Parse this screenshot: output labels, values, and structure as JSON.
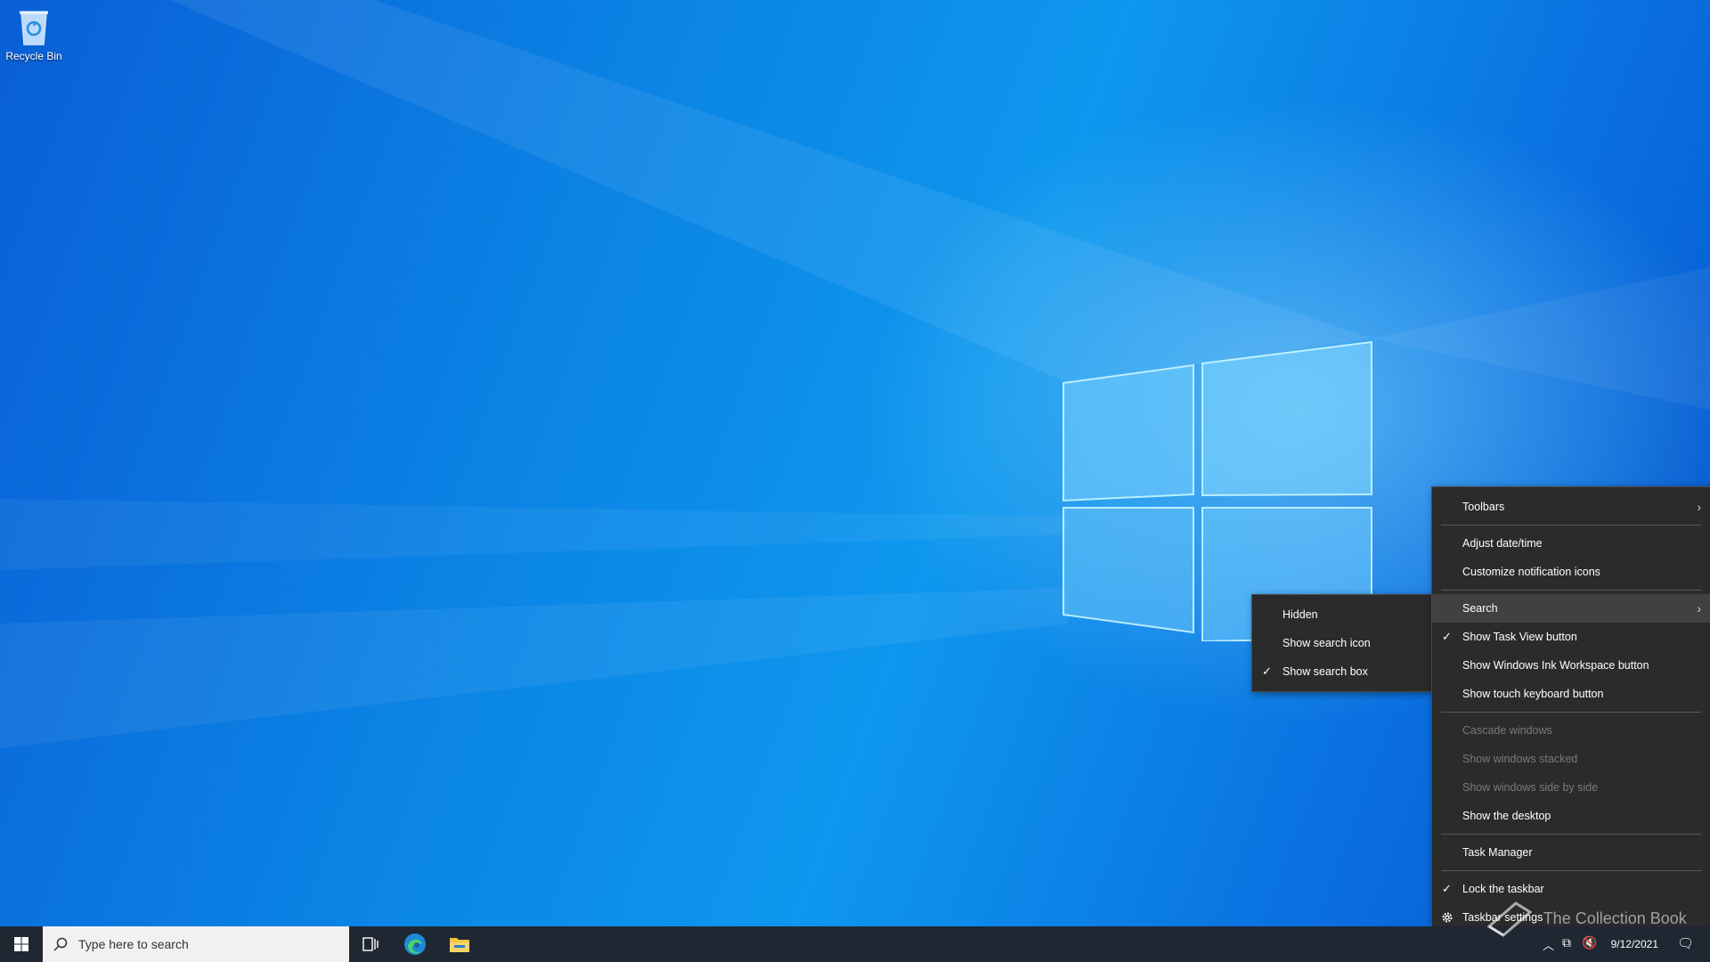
{
  "desktop": {
    "recycle_bin_label": "Recycle Bin"
  },
  "taskbar": {
    "search_placeholder": "Type here to search",
    "clock_date": "9/12/2021"
  },
  "watermark": "The Collection Book",
  "context_menu": {
    "items": [
      {
        "label": "Toolbars",
        "submenu": true
      },
      {
        "label": "Adjust date/time"
      },
      {
        "label": "Customize notification icons"
      },
      {
        "label": "Search",
        "submenu": true,
        "highlighted": true
      },
      {
        "label": "Show Task View button",
        "checked": true
      },
      {
        "label": "Show Windows Ink Workspace button"
      },
      {
        "label": "Show touch keyboard button"
      },
      {
        "label": "Cascade windows",
        "disabled": true
      },
      {
        "label": "Show windows stacked",
        "disabled": true
      },
      {
        "label": "Show windows side by side",
        "disabled": true
      },
      {
        "label": "Show the desktop"
      },
      {
        "label": "Task Manager"
      },
      {
        "label": "Lock the taskbar",
        "checked": true
      },
      {
        "label": "Taskbar settings",
        "icon": "gear-icon"
      }
    ]
  },
  "search_submenu": {
    "items": [
      {
        "label": "Hidden"
      },
      {
        "label": "Show search icon"
      },
      {
        "label": "Show search box",
        "checked": true
      }
    ]
  },
  "colors": {
    "menu_bg": "#2b2b2b",
    "taskbar_bg": "#1f2733",
    "desktop_blue": "#0b86e6"
  }
}
